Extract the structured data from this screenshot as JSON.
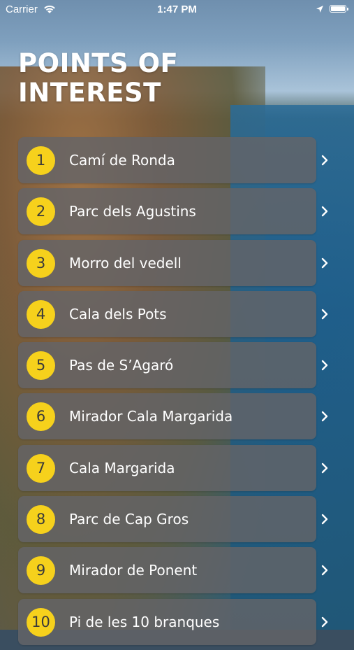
{
  "status_bar": {
    "carrier": "Carrier",
    "time": "1:47 PM",
    "wifi_icon": "wifi-icon",
    "location_icon": "location-arrow-icon",
    "battery_icon": "battery-full-icon",
    "battery_level": 1.0
  },
  "page": {
    "title": "POINTS OF\nINTEREST"
  },
  "points": [
    {
      "number": "1",
      "name": "Camí de Ronda"
    },
    {
      "number": "2",
      "name": "Parc dels Agustins"
    },
    {
      "number": "3",
      "name": "Morro del vedell"
    },
    {
      "number": "4",
      "name": "Cala dels Pots"
    },
    {
      "number": "5",
      "name": "Pas de S’Agaró"
    },
    {
      "number": "6",
      "name": "Mirador Cala Margarida"
    },
    {
      "number": "7",
      "name": "Cala Margarida"
    },
    {
      "number": "8",
      "name": "Parc de Cap Gros"
    },
    {
      "number": "9",
      "name": "Mirador de Ponent"
    },
    {
      "number": "10",
      "name": "Pi de les 10 branques"
    }
  ],
  "colors": {
    "badge": "#f6d11c",
    "badge_text": "#3a3a3a",
    "card": "#646468",
    "text": "#ffffff"
  }
}
